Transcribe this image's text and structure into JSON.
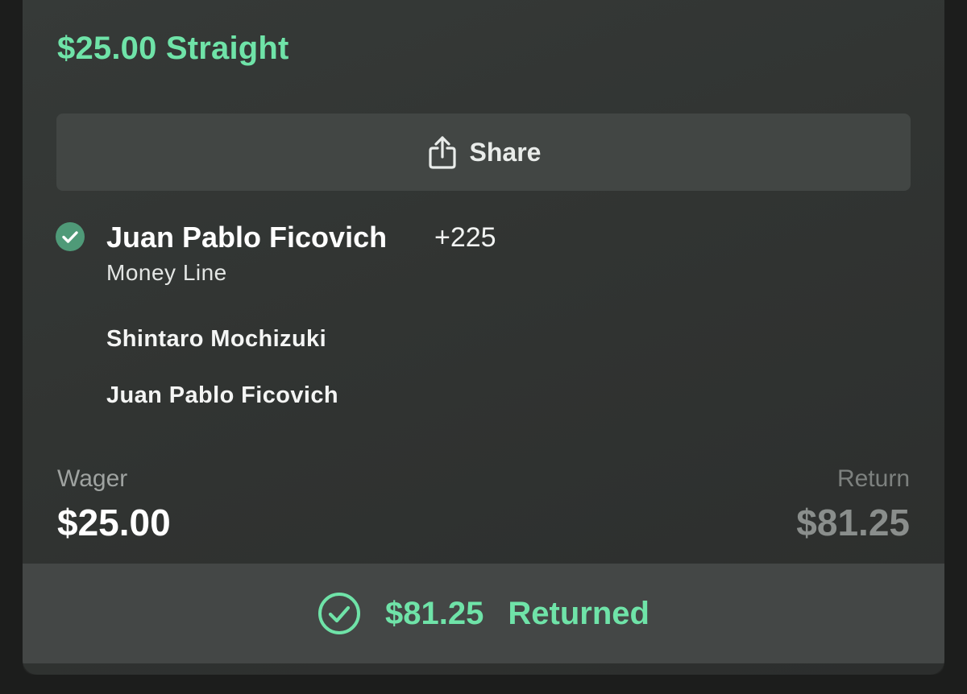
{
  "bet": {
    "title": "$25.00 Straight"
  },
  "share": {
    "label": "Share",
    "icon": "share-icon"
  },
  "selection": {
    "status_icon": "check-circle-icon",
    "name": "Juan Pablo Ficovich",
    "odds": "+225",
    "market": "Money Line"
  },
  "participants": [
    "Shintaro Mochizuki",
    "Juan Pablo Ficovich"
  ],
  "summary": {
    "wager_label": "Wager",
    "wager_value": "$25.00",
    "return_label": "Return",
    "return_value": "$81.25"
  },
  "result": {
    "icon": "check-circle-outline-icon",
    "amount": "$81.25",
    "status": "Returned"
  },
  "colors": {
    "accent": "#6fe3a8",
    "card_background": "#333634",
    "badge": "#4f9a78"
  }
}
